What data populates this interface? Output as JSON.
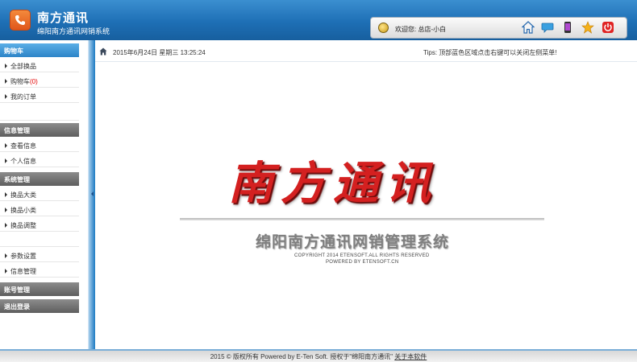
{
  "header": {
    "title": "南方通讯",
    "subtitle": "绵阳南方通讯网销系统",
    "welcome": "欢迎您: 总店-小白"
  },
  "sidebar": {
    "sections": [
      {
        "title": "购物车"
      },
      {
        "title": "信息管理"
      },
      {
        "title": "系统管理"
      },
      {
        "title": "账号管理"
      },
      {
        "title": "退出登录"
      }
    ],
    "cart_items": [
      {
        "label": "全部换品"
      },
      {
        "label": "购物车",
        "count": "(0)"
      },
      {
        "label": "我的订单"
      }
    ],
    "info_items": [
      {
        "label": "查看信息"
      },
      {
        "label": "个人信息"
      }
    ],
    "system_items": [
      {
        "label": "换品大类"
      },
      {
        "label": "换品小类"
      },
      {
        "label": "换品调整"
      },
      {
        "label": "参数设置"
      },
      {
        "label": "信息管理"
      }
    ]
  },
  "topbar": {
    "datetime": "2015年6月24日  星期三  13:25:24",
    "tips": "Tips: 顶部蓝色区域点击右键可以关闭左侧菜单!"
  },
  "main": {
    "brand": "南方通讯",
    "brand_subtitle": "绵阳南方通讯网销管理系统",
    "copyright_line1": "COPYRIGHT 2014 ETENSOFT.ALL RIGHTS RESERVED",
    "copyright_line2": "POWERED BY ETENSOFT.CN"
  },
  "footer": {
    "text": "2015 © 版权所有 Powered by E-Ten Soft.  授权于\"绵阳南方通讯\"",
    "about_link": "关于本软件"
  },
  "colors": {
    "header_blue": "#1e6fb5",
    "accent_red": "#d42020",
    "cart_count_red": "#e30000"
  },
  "icons": [
    "phone-icon",
    "user-avatar-icon",
    "home-icon",
    "message-icon",
    "mobile-icon",
    "star-icon",
    "power-icon"
  ]
}
